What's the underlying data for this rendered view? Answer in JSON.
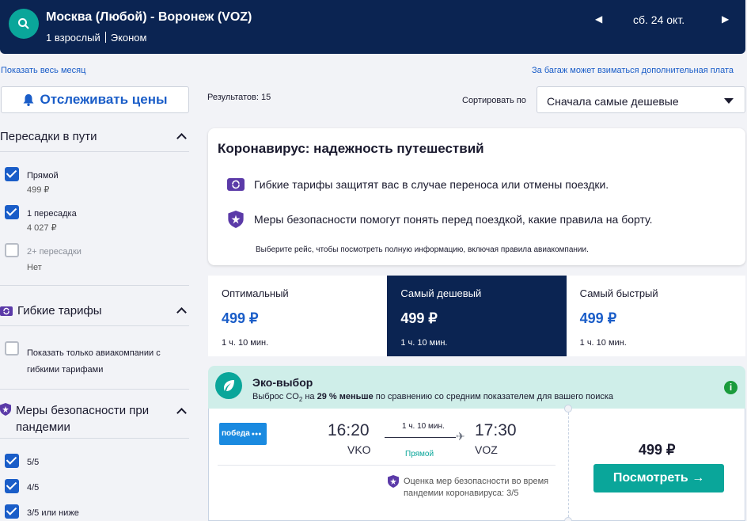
{
  "header": {
    "route": "Москва (Любой) - Воронеж (VOZ)",
    "passengers": "1 взрослый",
    "cabin": "Эконом",
    "date": "сб. 24 окт.",
    "prev_icon": "triangle-left",
    "next_icon": "triangle-right",
    "bg_color": "#0b2452",
    "accent": "#0aa69a"
  },
  "links": {
    "show_month": "Показать весь месяц",
    "baggage_fee": "За багаж может взиматься дополнительная плата"
  },
  "track_prices": {
    "label": "Отслеживать цены",
    "icon": "bell"
  },
  "results": {
    "label": "Результатов: 15"
  },
  "sort": {
    "label": "Сортировать по",
    "value": "Сначала самые дешевые"
  },
  "filters": {
    "stops": {
      "title": "Пересадки в пути",
      "options": [
        {
          "label": "Прямой",
          "sub": "499 ₽",
          "checked": true
        },
        {
          "label": "1 пересадка",
          "sub": "4 027 ₽",
          "checked": true
        },
        {
          "label": "2+ пересадки",
          "sub": "Нет",
          "checked": false
        }
      ]
    },
    "flexible": {
      "title": "Гибкие тарифы",
      "option": "Показать только авиакомпании с гибкими тарифами",
      "checked": false
    },
    "safety": {
      "title": "Меры безопасности при пандемии",
      "options": [
        {
          "label": "5/5",
          "checked": true
        },
        {
          "label": "4/5",
          "checked": true
        },
        {
          "label": "3/5 или ниже",
          "checked": true
        }
      ]
    }
  },
  "corona": {
    "title": "Коронавирус: надежность путешествий",
    "flex_text": "Гибкие тарифы защитят вас в случае переноса или отмены поездки.",
    "safety_text": "Меры безопасности помогут понять перед поездкой, какие правила на борту.",
    "note": "Выберите рейс, чтобы посмотреть полную информацию, включая правила авиакомпании."
  },
  "tabs": [
    {
      "name": "Оптимальный",
      "price": "499 ₽",
      "duration": "1 ч. 10 мин.",
      "active": false
    },
    {
      "name": "Самый дешевый",
      "price": "499 ₽",
      "duration": "1 ч. 10 мин.",
      "active": true
    },
    {
      "name": "Самый быстрый",
      "price": "499 ₽",
      "duration": "1 ч. 10 мин.",
      "active": false
    }
  ],
  "eco": {
    "title": "Эко-выбор",
    "text_before": "Выброс CO",
    "text_sub": "2",
    "text_mid": " на ",
    "text_bold": "29 % меньше",
    "text_after": " по сравнению со средним показателем для вашего поиска",
    "icon": "leaf",
    "info_icon": "i"
  },
  "flight": {
    "airline": "победа",
    "dep_time": "16:20",
    "dep_airport": "VKO",
    "duration": "1 ч. 10 мин.",
    "stops": "Прямой",
    "arr_time": "17:30",
    "arr_airport": "VOZ",
    "safety_text": "Оценка мер безопасности во время пандемии коронавируса: 3/5",
    "price": "499 ₽",
    "button": "Посмотреть →"
  }
}
